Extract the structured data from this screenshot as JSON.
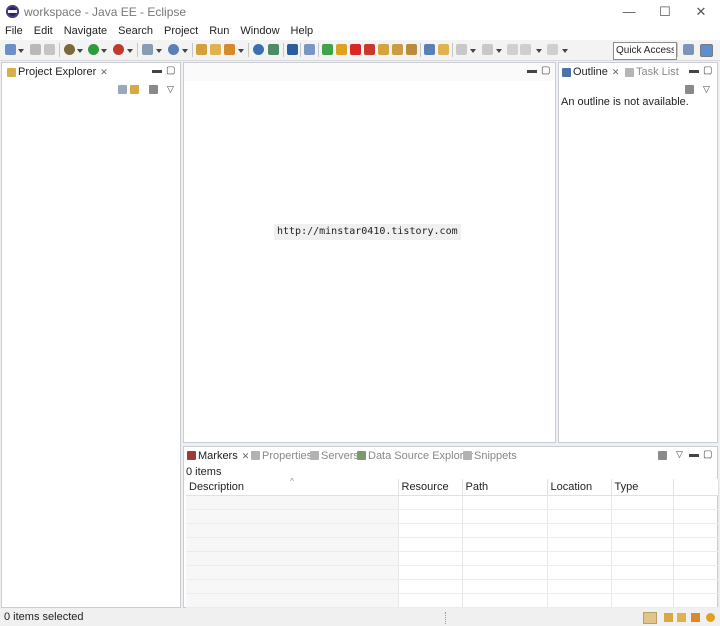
{
  "window": {
    "title": "workspace - Java EE - Eclipse",
    "min": "—",
    "max": "☐",
    "close": "✕"
  },
  "menu": [
    "File",
    "Edit",
    "Navigate",
    "Search",
    "Project",
    "Run",
    "Window",
    "Help"
  ],
  "toolbar": {
    "quick_access": "Quick Access"
  },
  "project_explorer": {
    "tab": "Project Explorer"
  },
  "outline": {
    "tab": "Outline",
    "tab2": "Task List",
    "message": "An outline is not available."
  },
  "bottom": {
    "tabs": [
      "Markers",
      "Properties",
      "Servers",
      "Data Source Explorer",
      "Snippets"
    ],
    "count": "0 items",
    "columns": [
      "Description",
      "Resource",
      "Path",
      "Location",
      "Type"
    ]
  },
  "status": "0 items selected",
  "watermark": "http://minstar0410.tistory.com",
  "colors": {
    "accent": "#2c2255",
    "border": "#c8cdd6",
    "background": "#f0f0f0"
  }
}
